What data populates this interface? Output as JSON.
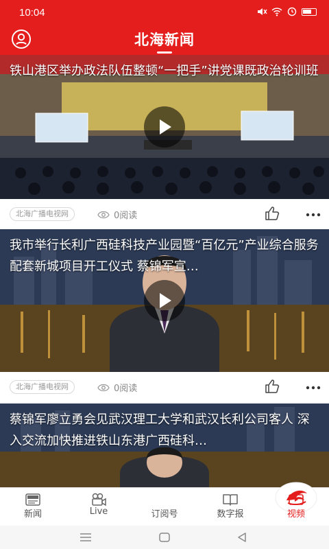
{
  "status_bar": {
    "time": "10:04"
  },
  "header": {
    "title": "北海新闻"
  },
  "feed": {
    "items": [
      {
        "title": "铁山港区举办政法队伍整顿“一把手”讲党课既政治轮训班",
        "source": "北海广播电视网",
        "reads": "0阅读"
      },
      {
        "title": "我市举行长利广西硅科技产业园暨“百亿元”产业综合服务配套新城项目开工仪式 蔡锦军宣…",
        "source": "北海广播电视网",
        "reads": "0阅读"
      },
      {
        "title": "蔡锦军廖立勇会见武汉理工大学和武汉长利公司客人 深入交流加快推进铁山东港广西硅科…",
        "source": "",
        "reads": ""
      }
    ]
  },
  "tabs": [
    {
      "label": "新闻",
      "icon": "newspaper-icon"
    },
    {
      "label": "Live",
      "icon": "video-camera-icon"
    },
    {
      "label": "订阅号",
      "icon": "dolphin-logo-icon"
    },
    {
      "label": "数字报",
      "icon": "open-book-icon"
    },
    {
      "label": "视频",
      "icon": "tv-play-icon"
    }
  ],
  "colors": {
    "brand_red": "#e41d1d",
    "active_tab": "#e41d1d"
  }
}
